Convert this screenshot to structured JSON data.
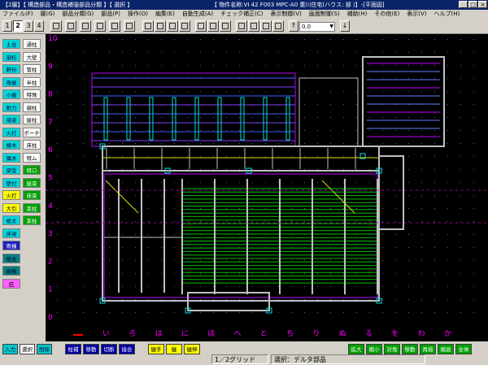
{
  "window": {
    "title_left": "【2層】【 構造部品・構造補強部品分類 】【 選択 】",
    "title_right": "【 物件名称:VI 42 F003 MPC-A0 重川住宅(ハウス: 部 )】-[平面図]",
    "min": "_",
    "max": "□",
    "close": "×"
  },
  "menu": [
    "ファイル(F)",
    "層(G)",
    "部品分類(G)",
    "部品(P)",
    "操作(O)",
    "編集(E)",
    "自動生成(A)",
    "チェック補正(C)",
    "表示制御(V)",
    "画面制御(S)",
    "補助(H)",
    "その他(E)",
    "表示(V)",
    "ヘルプ(H)"
  ],
  "toolbar": {
    "layers": [
      "1",
      "2",
      "3",
      "4"
    ],
    "active_layer": "2",
    "combo_value": "0.0",
    "up_arrow": "↑",
    "down_arrow": "↓"
  },
  "left_palette": {
    "col1": [
      "土台",
      "梁桁",
      "軒桁",
      "母屋",
      "小屋",
      "耐力",
      "母梁",
      "火打",
      "棟木",
      "隅木",
      "梁受",
      "壁付",
      "火打",
      "大引",
      "根太",
      "床梁",
      "寄棟",
      "根太",
      "屋根",
      "庇"
    ],
    "col2": [
      "通柱",
      "大壁",
      "管柱",
      "半柱",
      "特殊",
      "親柱",
      "屋柱",
      "ポーチ",
      "床柱",
      "特ム",
      "特ロ",
      "屋束",
      "床束",
      "束柱",
      "束柱"
    ]
  },
  "grid": {
    "row_numbers": [
      "10",
      "9",
      "8",
      "7",
      "6",
      "5",
      "4",
      "3",
      "2",
      "1",
      "0"
    ],
    "col_labels": [
      "い",
      "ろ",
      "は",
      "に",
      "ほ",
      "へ",
      "と",
      "ち",
      "り",
      "ぬ",
      "る",
      "を",
      "わ",
      "か"
    ]
  },
  "bottom_left": [
    "入力",
    "選択",
    "削除"
  ],
  "bottom_mid": [
    "柱補",
    "移動",
    "切断",
    "接合"
  ],
  "bottom_mid2": [
    "継手",
    "継",
    "継伸"
  ],
  "bottom_right": [
    "拡大",
    "縮小",
    "対角",
    "移動",
    "再描",
    "縮退",
    "全体"
  ],
  "status": {
    "grid": "1／2グリッド",
    "selection": "選択：デルタ部品"
  },
  "colors": {
    "canvas_bg": "#000000",
    "grid_label": "#ff00ff",
    "wall_purple": "#c000ff",
    "beam_green": "#00c000",
    "cyan": "#00e0e0",
    "gray_member": "#c0c0c0",
    "yellow": "#e0e000"
  }
}
